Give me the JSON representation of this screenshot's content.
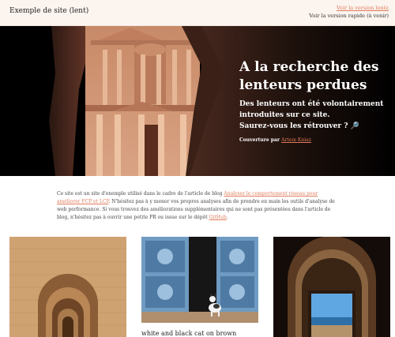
{
  "header": {
    "site_title": "Exemple de site (lent)",
    "nav_slow": "Voir la version lente",
    "nav_fast": "Voir la version rapide (à venir)"
  },
  "hero": {
    "title": "A la recherche des lenteurs perdues",
    "subtitle_line1": "Des lenteurs ont été volontairement",
    "subtitle_line2": "introduites sur ce site.",
    "subtitle_line3": "Saurez-vous les rétrouver ? 🔎",
    "credit_prefix": "Couverture par",
    "credit_name": "Artem Kniaz"
  },
  "intro": {
    "text1": "Ce site est un site d'exemple utilisé dans le cadre de l'article de blog",
    "link1": "Analyser le comportement réseau pour améliorer FCP et LCP",
    "text2": ". N'hésitez pas à y mener vos propres analyses afin de prendre en main les outils d'analyse de web performance. Si vous trouvez des améliorations supplémentaires qui ne sont pas présentées dans l'article de blog, n'hésitez pas à ouvrir une petite PR ou issue sur le dépôt",
    "link2": "GitHub",
    "text3": "."
  },
  "cards": [
    {
      "caption": ""
    },
    {
      "caption": "white and black cat on brown wooden"
    },
    {
      "caption": ""
    }
  ],
  "colors": {
    "accent": "#e07b5a",
    "header_bg": "#fbf4ef",
    "hero_bg": "#000000"
  }
}
